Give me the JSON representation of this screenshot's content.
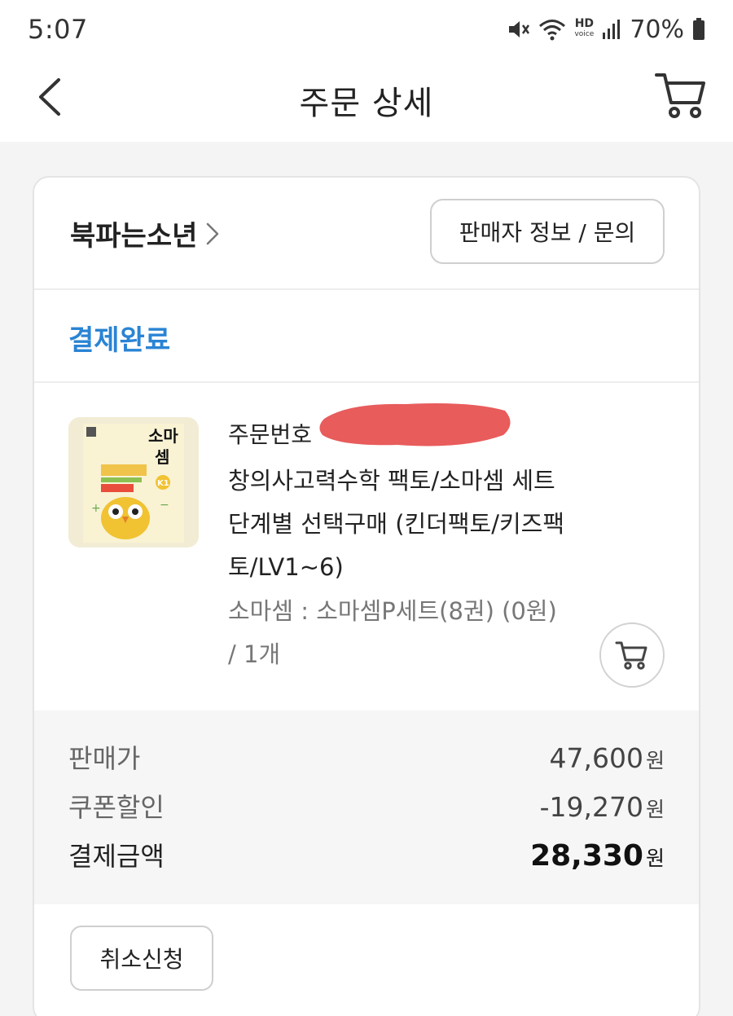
{
  "status_bar": {
    "time": "5:07",
    "hd_label": "HD",
    "hd_sub": "voice",
    "battery": "70%"
  },
  "header": {
    "title": "주문 상세",
    "back_icon": "chevron-left-icon",
    "cart_icon": "cart-icon"
  },
  "seller": {
    "name": "북파는소년",
    "chevron": "›",
    "info_button": "판매자 정보 / 문의"
  },
  "order": {
    "status": "결제완료",
    "status_color": "#2a84d4",
    "order_number_label": "주문번호"
  },
  "product": {
    "title": "창의사고력수학 팩토/소마셈 세트 단계별 선택구매 (킨더팩토/키즈팩토/LV1~6)",
    "option": "소마셈 : 소마셈P세트(8권) (0원) / 1개",
    "thumb_text_top": "소마",
    "thumb_text_bottom": "셈",
    "thumb_badge": "K1"
  },
  "prices": {
    "sale_label": "판매가",
    "sale_value": "47,600",
    "coupon_label": "쿠폰할인",
    "coupon_value": "-19,270",
    "total_label": "결제금액",
    "total_value": "28,330",
    "unit": "원"
  },
  "actions": {
    "cancel_button": "취소신청"
  }
}
